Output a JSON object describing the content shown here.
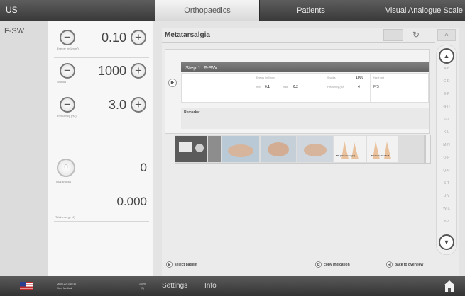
{
  "header": {
    "mode": "US",
    "tabs": [
      {
        "label": "Orthopaedics",
        "active": true
      },
      {
        "label": "Patients",
        "active": false
      },
      {
        "label": "Visual Analogue Scale",
        "active": false
      }
    ]
  },
  "protocols": {
    "items": [
      {
        "label": "F-SW"
      }
    ]
  },
  "parameters": {
    "energy": {
      "value": "0.10",
      "unit": "Energy (mJ/mm²)"
    },
    "shocks": {
      "value": "1000",
      "unit": "Shocks"
    },
    "frequency": {
      "value": "3.0",
      "unit": "Frequency (Hz)"
    },
    "total_shocks": {
      "value": "0",
      "label": "Total shocks"
    },
    "total_energy": {
      "value": "0.000",
      "label": "Total energy (J)"
    }
  },
  "main": {
    "title": "Metatarsalgia",
    "step": {
      "header": "Step 1: F-SW",
      "energy_label": "Energy (mJ/mm²)",
      "min_label": "min",
      "min_value": "0.1",
      "max_label": "max",
      "max_value": "0.2",
      "shocks_label": "Shocks",
      "shocks_value": "1000",
      "frequency_label": "Frequency (Hz)",
      "frequency_value": "4",
      "handpiece_label": "Hand unit",
      "handpiece_value": "F/S"
    },
    "remarks_label": "Remarks:",
    "image_captions": [
      "Mtk (Metatarsalgie)",
      "Mortonischer Fuß"
    ],
    "az_letters": [
      "A-B",
      "C-D",
      "E-F",
      "G-H",
      "I-J",
      "K-L",
      "M-N",
      "O-P",
      "Q-R",
      "S-T",
      "U-V",
      "W-X",
      "Y-Z"
    ],
    "az_top": "A",
    "actions": {
      "select_patient": "select patient",
      "copy_indication": "copy indication",
      "back_to_overview": "back to overview"
    }
  },
  "statusbar": {
    "date": "26.08.2013 10:30",
    "user": "Storz Medical",
    "battery_percent": "100%",
    "battery_label": "(S)",
    "settings": "Settings",
    "info": "Info"
  },
  "colors": {
    "bar_dark": "#3a3a3a",
    "active_tab": "#e8e8e8",
    "step_header": "#6e6e6e"
  }
}
